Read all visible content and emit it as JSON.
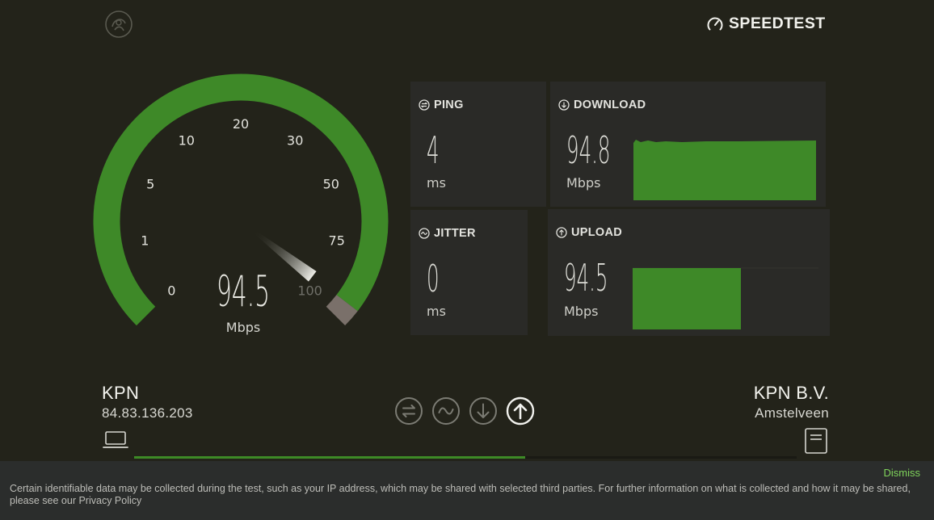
{
  "brand": {
    "name": "SPEEDTEST",
    "icon": "speedometer-icon"
  },
  "gauge": {
    "value": "94.5",
    "unit": "Mbps",
    "scale_labels": [
      "0",
      "1",
      "5",
      "10",
      "20",
      "30",
      "50",
      "75",
      "100"
    ],
    "fill_color": "#3e8928",
    "cap_color": "#7a706a"
  },
  "ping": {
    "label": "PING",
    "value": "4",
    "unit": "ms",
    "icon": "ping-icon"
  },
  "download": {
    "label": "DOWNLOAD",
    "value": "94.8",
    "unit": "Mbps",
    "icon": "download-icon",
    "color": "#3e8928"
  },
  "jitter": {
    "label": "JITTER",
    "value": "0",
    "unit": "ms",
    "icon": "jitter-icon"
  },
  "upload": {
    "label": "UPLOAD",
    "value": "94.5",
    "unit": "Mbps",
    "icon": "upload-icon",
    "color": "#3e8928"
  },
  "client": {
    "isp": "KPN",
    "ip": "84.83.136.203",
    "icon": "laptop-icon"
  },
  "server": {
    "name": "KPN B.V.",
    "location": "Amstelveen",
    "icon": "document-icon"
  },
  "test_steps": [
    {
      "name": "ping",
      "icon": "ping-step-icon",
      "active": false
    },
    {
      "name": "jitter",
      "icon": "jitter-step-icon",
      "active": false
    },
    {
      "name": "download",
      "icon": "download-step-icon",
      "active": false
    },
    {
      "name": "upload",
      "icon": "upload-step-icon",
      "active": true
    }
  ],
  "progress": {
    "fraction": 0.59,
    "color": "#3d8a26"
  },
  "cookie_notice": {
    "dismiss_label": "Dismiss",
    "text": "Certain identifiable data may be collected during the test, such as your IP address, which may be shared with selected third parties. For further information on what is collected and how it may be shared, please see our Privacy Policy"
  },
  "colors": {
    "background": "#23231a",
    "tile": "#2a2a27",
    "accent_green": "#3e8928",
    "dismiss_green": "#7fd35b"
  }
}
